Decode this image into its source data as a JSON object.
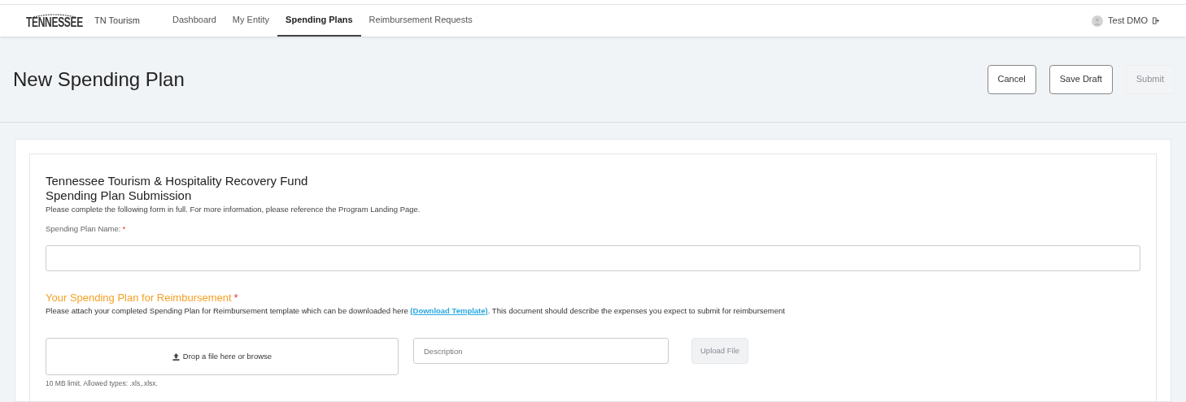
{
  "nav": {
    "logo_text": "TENNESSEE",
    "brand": "TN Tourism",
    "items": [
      {
        "label": "Dashboard",
        "selected": false
      },
      {
        "label": "My Entity",
        "selected": false
      },
      {
        "label": "Spending Plans",
        "selected": true
      },
      {
        "label": "Reimbursement Requests",
        "selected": false
      }
    ],
    "user": "Test DMO"
  },
  "page": {
    "title": "New Spending Plan",
    "buttons": [
      {
        "label": "Cancel",
        "disabled": false
      },
      {
        "label": "Save Draft",
        "disabled": false
      },
      {
        "label": "Submit",
        "disabled": true
      }
    ]
  },
  "form": {
    "title": "Tennessee Tourism & Hospitality Recovery Fund",
    "subtitle": "Spending Plan Submission",
    "intro": "Please complete the following form in full. For more information, please reference the Program Landing Page.",
    "name_label": "Spending Plan Name:",
    "name_required": "*",
    "section_title": "Your Spending Plan for Reimbursement",
    "section_required": "*",
    "section_text_before": "Please attach your completed Spending Plan for Reimbursement template which can be downloaded here",
    "section_link": "(Download Template)",
    "section_text_after": ". This document should describe the expenses you expect to submit for reimbursement",
    "dropzone": "Drop a file here or browse",
    "description_placeholder": "Description",
    "upload_button": {
      "label": "Upload File",
      "disabled": true
    },
    "limit_note": "10 MB limit. Allowed types: .xls,.xlsx."
  }
}
